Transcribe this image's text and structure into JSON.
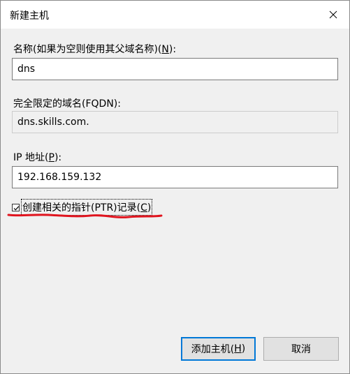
{
  "window": {
    "title": "新建主机",
    "close_icon": "close-icon"
  },
  "name_field": {
    "label": "名称(如果为空则使用其父域名称)(",
    "mnemonic": "N",
    "label_end": "):",
    "value": "dns"
  },
  "fqdn_field": {
    "label": "完全限定的域名(FQDN):",
    "value": "dns.skills.com."
  },
  "ip_field": {
    "label": "IP 地址(",
    "mnemonic": "P",
    "label_end": "):",
    "value": "192.168.159.132"
  },
  "ptr_checkbox": {
    "checked": true,
    "label": "创建相关的指针(PTR)记录(",
    "mnemonic": "C",
    "label_end": ")"
  },
  "buttons": {
    "add_host": {
      "label": "添加主机(",
      "mnemonic": "H",
      "label_end": ")"
    },
    "cancel": {
      "label": "取消"
    }
  },
  "colors": {
    "annotation": "#e0141e",
    "focus_border": "#0078d7"
  }
}
